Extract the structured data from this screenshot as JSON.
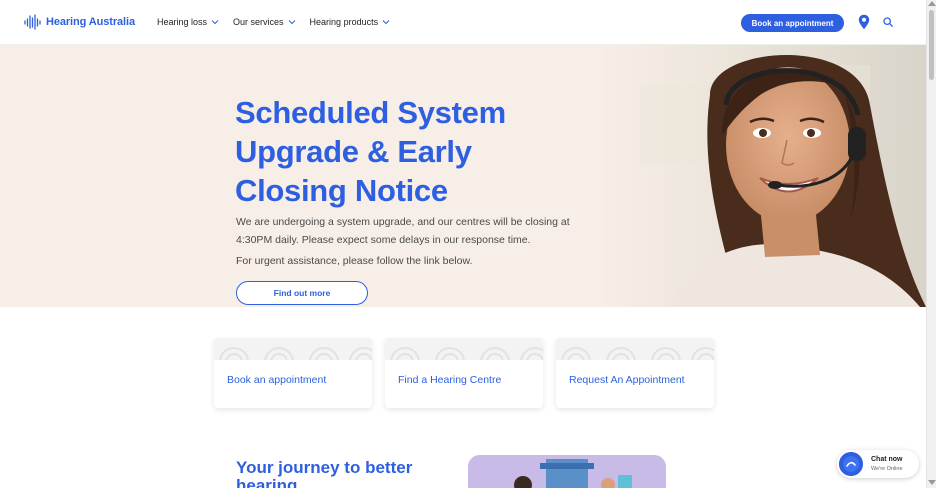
{
  "header": {
    "logo_text": "Hearing Australia",
    "nav": [
      {
        "label": "Hearing loss"
      },
      {
        "label": "Our services"
      },
      {
        "label": "Hearing products"
      }
    ],
    "book_button": "Book an appointment"
  },
  "hero": {
    "title": "Scheduled System Upgrade & Early Closing Notice",
    "body": "We are undergoing a system upgrade, and our centres will be closing at 4:30PM daily. Please expect some delays in our response time.",
    "body2": "For urgent assistance, please follow the link below.",
    "cta": "Find out more"
  },
  "cards": [
    {
      "label": "Book an appointment"
    },
    {
      "label": "Find a Hearing Centre"
    },
    {
      "label": "Request An Appointment"
    }
  ],
  "journey": {
    "title": "Your journey to better hearing"
  },
  "chat": {
    "title": "Chat now",
    "status": "We're Online"
  },
  "colors": {
    "brand_blue": "#2d5fe0",
    "hero_bg": "#f7eee7"
  },
  "icons": [
    "hearing-australia-logo",
    "chevron-down-icon",
    "location-pin-icon",
    "search-icon",
    "chat-icon"
  ]
}
